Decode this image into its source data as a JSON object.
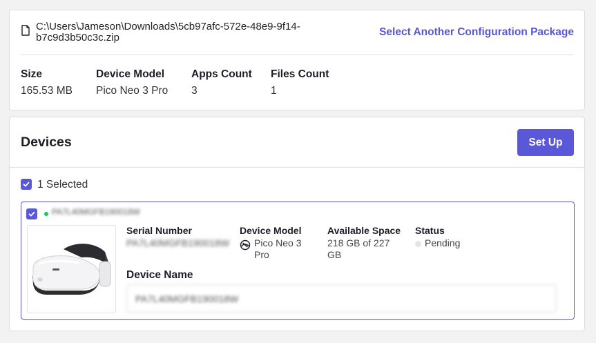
{
  "package": {
    "file_path": "C:\\Users\\Jameson\\Downloads\\5cb97afc-572e-48e9-9f14-b7c9d3b50c3c.zip",
    "select_link": "Select Another Configuration Package",
    "stats": [
      {
        "label": "Size",
        "value": "165.53 MB"
      },
      {
        "label": "Device Model",
        "value": "Pico Neo 3 Pro"
      },
      {
        "label": "Apps Count",
        "value": "3"
      },
      {
        "label": "Files Count",
        "value": "1"
      }
    ]
  },
  "devices": {
    "title": "Devices",
    "setup_label": "Set Up",
    "selected_text": "1 Selected",
    "items": [
      {
        "serial_header": "PA7L40MGFB190018W",
        "serial_label": "Serial Number",
        "serial_value": "PA7L40MGFB190018W",
        "model_label": "Device Model",
        "model_value": "Pico Neo 3 Pro",
        "space_label": "Available Space",
        "space_value": "218 GB of 227 GB",
        "status_label": "Status",
        "status_value": "Pending",
        "name_label": "Device Name",
        "name_value": "PA7L40MGFB190018W"
      }
    ]
  },
  "colors": {
    "accent": "#5a58d8",
    "online": "#22c55e",
    "pending": "#e4e4e7"
  },
  "icons": [
    "file-icon",
    "check-icon",
    "headset-icon",
    "status-dot"
  ]
}
